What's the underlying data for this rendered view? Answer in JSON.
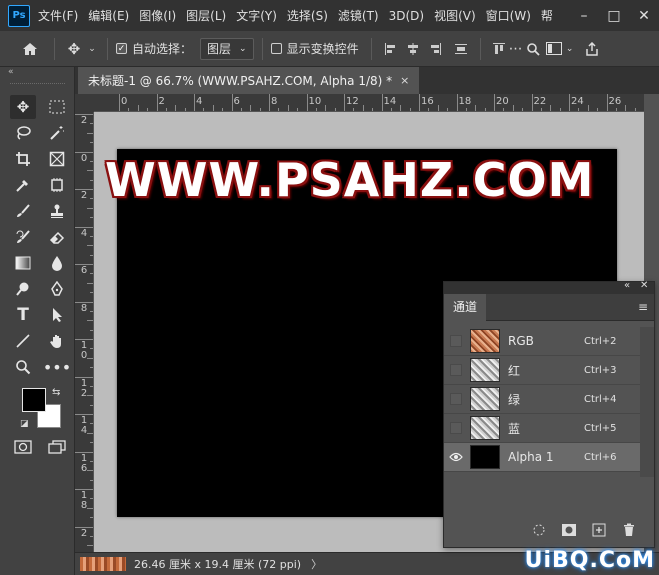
{
  "menubar": {
    "logo": "Ps",
    "items": [
      "文件(F)",
      "编辑(E)",
      "图像(I)",
      "图层(L)",
      "文字(Y)",
      "选择(S)",
      "滤镜(T)",
      "3D(D)",
      "视图(V)",
      "窗口(W)",
      "帮"
    ],
    "window_buttons": [
      "–",
      "□",
      "✕"
    ]
  },
  "options": {
    "home_icon": "home-icon",
    "auto_select_label": "自动选择：",
    "auto_select_checked": true,
    "layer_select_value": "图层",
    "show_transform_label": "显示变换控件",
    "show_transform_checked": false
  },
  "document": {
    "tab_title": "未标题-1 @ 66.7% (WWW.PSAHZ.COM, Alpha 1/8) *",
    "close_glyph": "×",
    "canvas_text": "WWW.PSAHZ.COM",
    "ruler_h_labels": [
      "0",
      "2",
      "4",
      "6",
      "8",
      "10",
      "12",
      "14",
      "16",
      "18",
      "20",
      "22",
      "24",
      "26"
    ],
    "ruler_v_labels": [
      "2",
      "0",
      "2",
      "4",
      "6",
      "8",
      "10",
      "12",
      "14",
      "16",
      "18",
      "2"
    ]
  },
  "status": {
    "dimensions": "26.46 厘米 x 19.4 厘米 (72 ppi)",
    "arrow": "〉"
  },
  "channels_panel": {
    "collapse_glyph": "«",
    "close_glyph": "✕",
    "tab": "通道",
    "menu_glyph": "≡",
    "rows": [
      {
        "name": "RGB",
        "shortcut": "Ctrl+2",
        "visible": false,
        "selected": false,
        "thumb": "rgb"
      },
      {
        "name": "红",
        "shortcut": "Ctrl+3",
        "visible": false,
        "selected": false,
        "thumb": "gray"
      },
      {
        "name": "绿",
        "shortcut": "Ctrl+4",
        "visible": false,
        "selected": false,
        "thumb": "gray"
      },
      {
        "name": "蓝",
        "shortcut": "Ctrl+5",
        "visible": false,
        "selected": false,
        "thumb": "gray"
      },
      {
        "name": "Alpha 1",
        "shortcut": "Ctrl+6",
        "visible": true,
        "selected": true,
        "thumb": "black"
      }
    ]
  },
  "toolbar": {
    "collapse_glyph": "«"
  },
  "watermark": "UiBQ.CoM"
}
